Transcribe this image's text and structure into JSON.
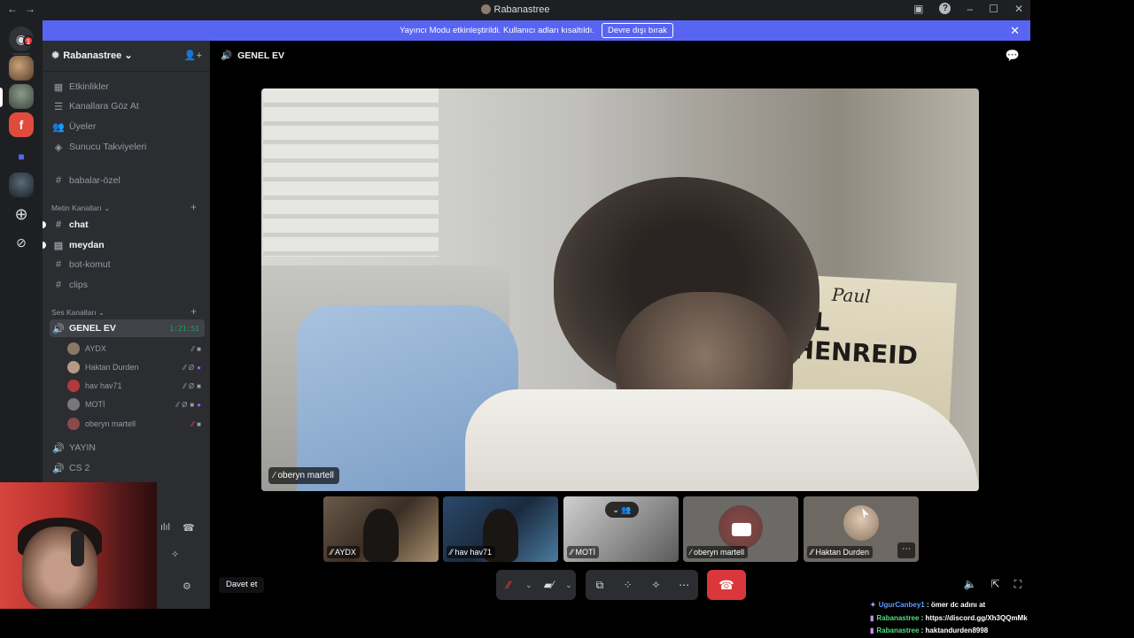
{
  "window": {
    "title": "Rabanastree"
  },
  "banner": {
    "message": "Yayıncı Modu etkinleştirildi. Kullanıcı adları kısaltıldı.",
    "button": "Devre dışı bırak"
  },
  "rail": {
    "badge": "1"
  },
  "server": {
    "name": "Rabanastree"
  },
  "sidebar": {
    "top_items": [
      {
        "label": "Etkinlikler",
        "icon": "calendar-icon"
      },
      {
        "label": "Kanallara Göz At",
        "icon": "browse-icon"
      },
      {
        "label": "Üyeler",
        "icon": "members-icon"
      },
      {
        "label": "Sunucu Takviyeleri",
        "icon": "boost-icon"
      }
    ],
    "pinned_channel": "babalar-özel",
    "text_category": "Metin Kanalları",
    "text_channels": [
      "chat",
      "meydan",
      "bot-komut",
      "clips"
    ],
    "voice_category": "Ses Kanalları",
    "active_voice": {
      "label": "GENEL EV",
      "timer": "1:21:51"
    },
    "voice_users": [
      "AYDX",
      "Haktan Durden",
      "hav hav71",
      "MOTİ",
      "oberyn martell"
    ],
    "other_voice": [
      "YAYIN",
      "CS 2"
    ]
  },
  "main": {
    "channel_title": "GENEL EV",
    "main_video_name": "oberyn martell",
    "poster_line1": "Paul",
    "poster_line2": "AL HENREID",
    "thumbs": [
      "AYDX",
      "hav hav71",
      "MOTİ",
      "oberyn martell",
      "Haktan Durden"
    ],
    "invite_button": "Davet et"
  },
  "overlay_chat": [
    {
      "user": "UgurCanbey1",
      "text": "ömer dc adını at"
    },
    {
      "user": "Rabanastree",
      "text": "https://discord.gg/Xh3QQmMk"
    },
    {
      "user": "Rabanastree",
      "text": "haktandurden8998"
    }
  ],
  "colors": {
    "accent": "#5865f2",
    "danger": "#da373c",
    "online": "#23a55a"
  }
}
